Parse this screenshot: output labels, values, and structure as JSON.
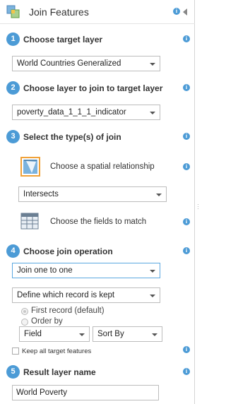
{
  "header": {
    "title": "Join Features",
    "tool_icon": "join-features-icon"
  },
  "steps": [
    {
      "number": "1",
      "title": "Choose target layer",
      "value": "World Countries Generalized"
    },
    {
      "number": "2",
      "title": "Choose layer to join to target layer",
      "value": "poverty_data_1_1_1_indicator"
    },
    {
      "number": "3",
      "title": "Select the type(s) of join"
    },
    {
      "number": "4",
      "title": "Choose join operation"
    },
    {
      "number": "5",
      "title": "Result layer name"
    }
  ],
  "join_types": {
    "spatial_label": "Choose a spatial relationship",
    "spatial_value": "Intersects",
    "fields_label": "Choose the fields to match"
  },
  "operation": {
    "value": "Join one to one",
    "record_kept": "Define which record is kept",
    "radio_first": "First record (default)",
    "radio_order": "Order by",
    "field_dropdown": "Field",
    "sort_dropdown": "Sort By",
    "keep_all_label": "Keep all target features"
  },
  "result": {
    "layer_name": "World Poverty"
  },
  "info_glyph": "i",
  "colors": {
    "accent": "#4c9bd6",
    "highlight": "#f0a23a"
  }
}
